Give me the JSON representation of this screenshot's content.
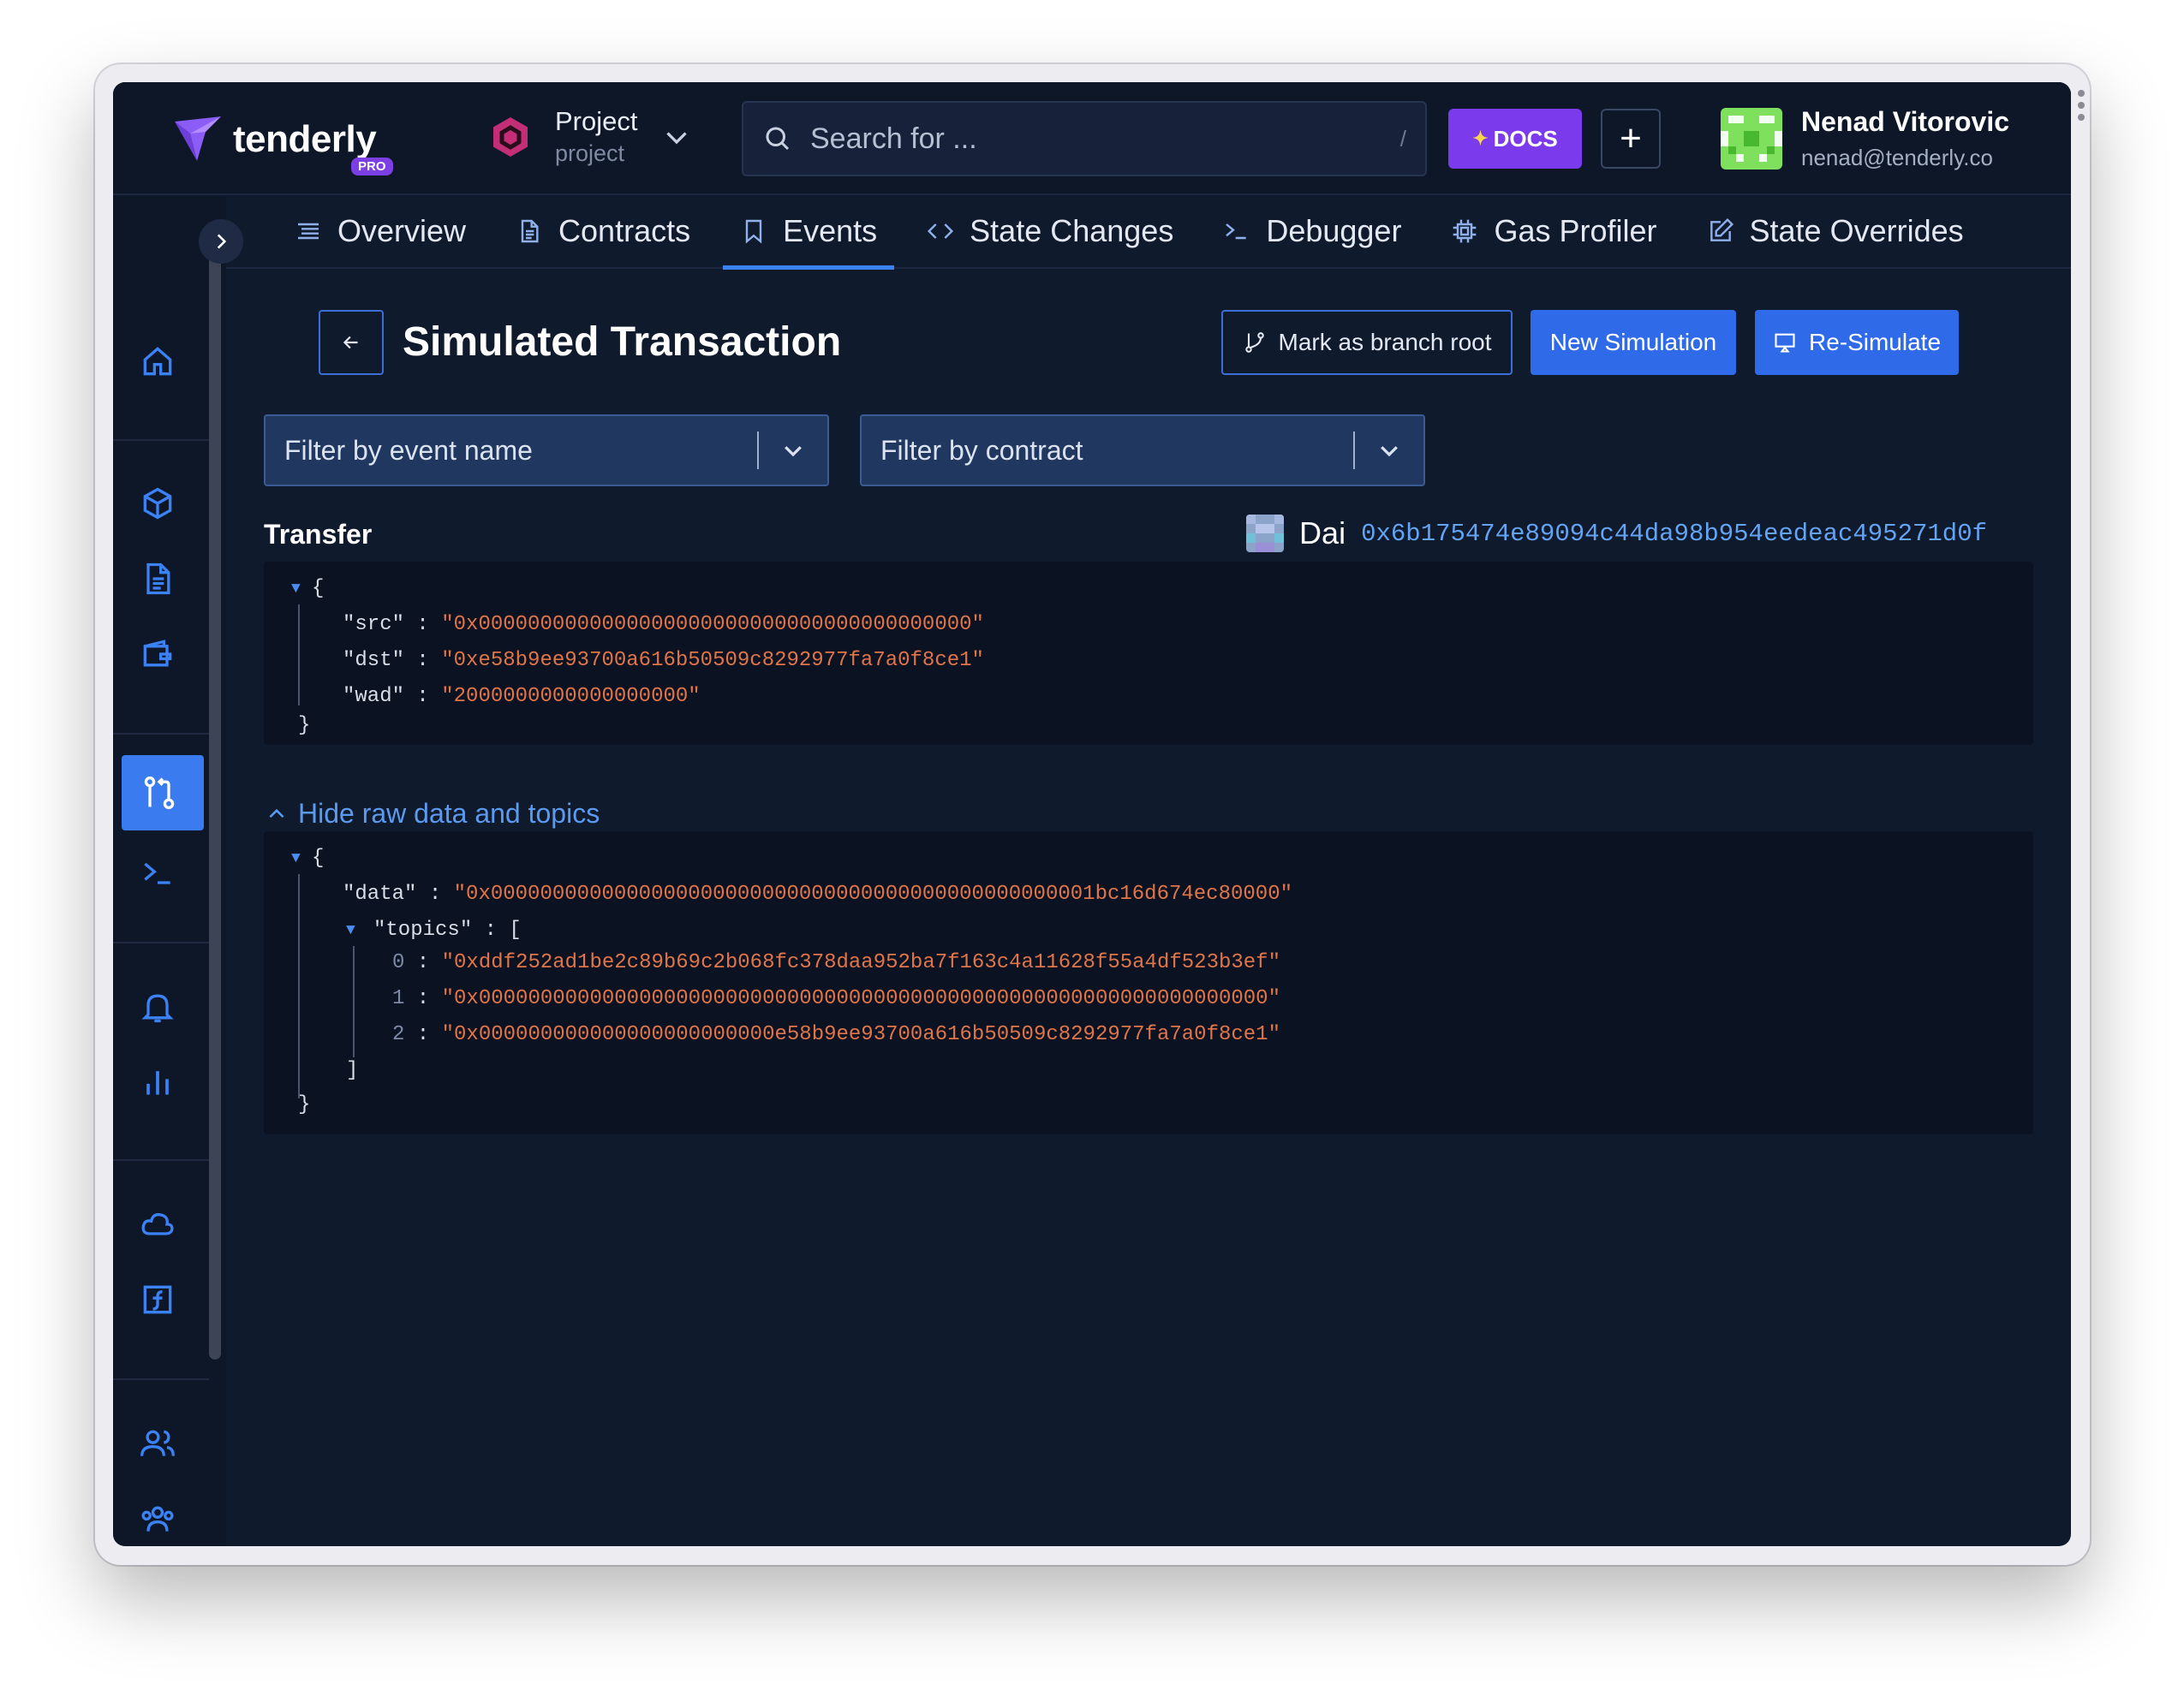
{
  "header": {
    "logo_text": "tenderly",
    "plan_badge": "PRO",
    "project_name": "Project",
    "project_slug": "project",
    "search_placeholder": "Search for ...",
    "search_shortcut": "/",
    "docs_label": "DOCS",
    "plus_label": "+",
    "user_name": "Nenad Vitorovic",
    "user_email": "nenad@tenderly.co"
  },
  "tabs": [
    {
      "label": "Overview",
      "icon": "list-icon"
    },
    {
      "label": "Contracts",
      "icon": "document-icon"
    },
    {
      "label": "Events",
      "icon": "bookmark-icon",
      "active": true
    },
    {
      "label": "State Changes",
      "icon": "code-icon"
    },
    {
      "label": "Debugger",
      "icon": "terminal-icon"
    },
    {
      "label": "Gas Profiler",
      "icon": "chip-icon"
    },
    {
      "label": "State Overrides",
      "icon": "edit-icon"
    }
  ],
  "sidebar": {
    "icons": [
      "home-icon",
      "cube-icon",
      "file-icon",
      "wallet-icon",
      "monitor-icon",
      "simulation-icon",
      "terminal-icon",
      "bell-icon",
      "analytics-icon",
      "cloud-icon",
      "function-icon",
      "users-icon",
      "team-icon"
    ],
    "active": "simulation-icon"
  },
  "page": {
    "title": "Simulated Transaction",
    "branch_button": "Mark as branch root",
    "new_simulation_button": "New Simulation",
    "resimulate_button": "Re-Simulate"
  },
  "filters": {
    "event_name": "Filter by event name",
    "contract": "Filter by contract"
  },
  "event": {
    "name": "Transfer",
    "contract_name": "Dai",
    "contract_address": "0x6b175474e89094c44da98b954eedeac495271d0f",
    "params": {
      "src_key": "\"src\"",
      "src": "\"0x0000000000000000000000000000000000000000\"",
      "dst_key": "\"dst\"",
      "dst": "\"0xe58b9ee93700a616b50509c8292977fa7a0f8ce1\"",
      "wad_key": "\"wad\"",
      "wad": "\"2000000000000000000\""
    },
    "raw_toggle": "Hide raw data and topics",
    "raw": {
      "data_key": "\"data\"",
      "data": "\"0x0000000000000000000000000000000000000000000000001bc16d674ec80000\"",
      "topics_key": "\"topics\"",
      "topics": [
        "\"0xddf252ad1be2c89b69c2b068fc378daa952ba7f163c4a11628f55a4df523b3ef\"",
        "\"0x0000000000000000000000000000000000000000000000000000000000000000\"",
        "\"0x000000000000000000000000e58b9ee93700a616b50509c8292977fa7a0f8ce1\""
      ],
      "topic_indices": [
        "0",
        "1",
        "2"
      ]
    }
  },
  "colors": {
    "accent": "#3b82f6",
    "docs": "#7c3aed",
    "string": "#e0754a",
    "address": "#63a4f4",
    "background": "#101a2d"
  }
}
